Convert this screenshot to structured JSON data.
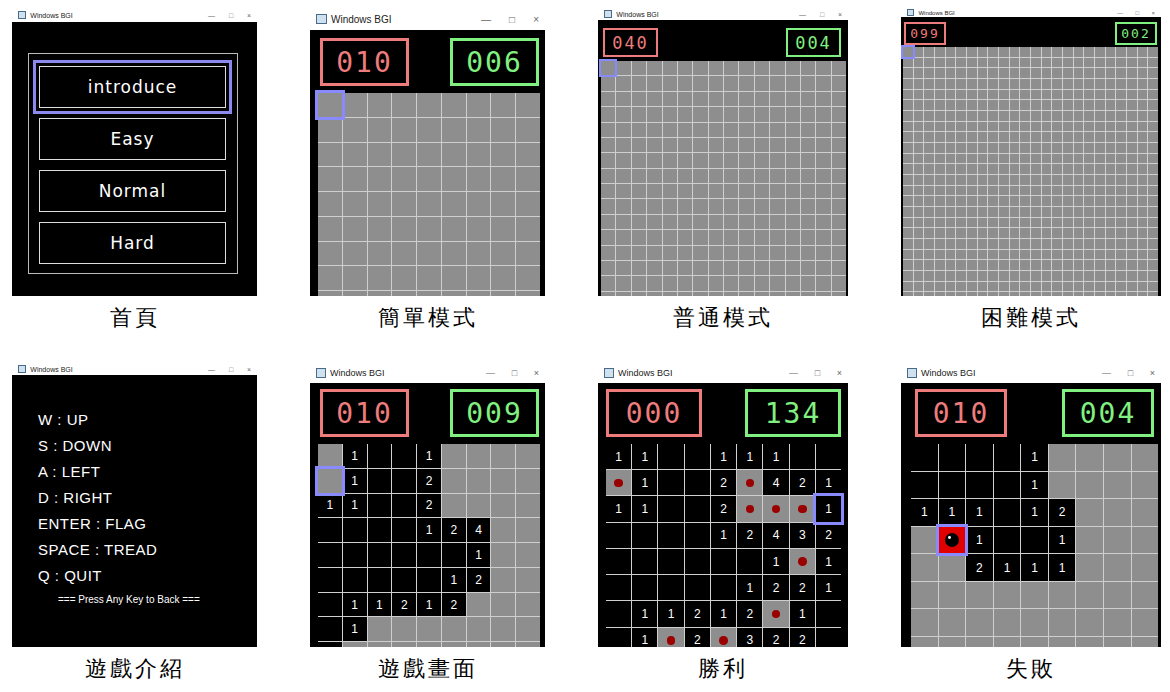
{
  "window": {
    "title": "Windows BGI",
    "controls": [
      "—",
      "□",
      "×"
    ]
  },
  "panels": [
    {
      "kind": "menu",
      "caption": "首頁",
      "options": [
        {
          "label": "introduce",
          "selected": true
        },
        {
          "label": "Easy",
          "selected": false
        },
        {
          "label": "Normal",
          "selected": false
        },
        {
          "label": "Hard",
          "selected": false
        }
      ]
    },
    {
      "kind": "board",
      "caption": "簡單模式",
      "mines": "010",
      "time": "006",
      "cursor": {
        "row": 0,
        "col": 0
      },
      "rows": [
        "#########",
        "#########",
        "#########",
        "#########",
        "#########",
        "#########",
        "#########",
        "#########",
        "#########"
      ]
    },
    {
      "kind": "board",
      "caption": "普通模式",
      "mines": "040",
      "time": "004",
      "cursor": {
        "row": 0,
        "col": 0
      },
      "rows": [
        "################",
        "################",
        "################",
        "################",
        "################",
        "################",
        "################",
        "################",
        "################",
        "################",
        "################",
        "################",
        "################",
        "################",
        "################",
        "################"
      ]
    },
    {
      "kind": "board",
      "caption": "困難模式",
      "mines": "099",
      "time": "002",
      "cursor": {
        "row": 0,
        "col": 0
      },
      "rows": [
        "########################",
        "########################",
        "########################",
        "########################",
        "########################",
        "########################",
        "########################",
        "########################",
        "########################",
        "########################",
        "########################",
        "########################",
        "########################",
        "########################",
        "########################",
        "########################",
        "########################",
        "########################",
        "########################",
        "########################",
        "########################",
        "########################",
        "########################",
        "########################"
      ]
    },
    {
      "kind": "intro",
      "caption": "遊戲介紹",
      "lines": [
        "W : UP",
        "S : DOWN",
        "A : LEFT",
        "D : RIGHT",
        "ENTER : FLAG",
        "SPACE : TREAD",
        "Q : QUIT"
      ],
      "hint": "=== Press Any Key to Back ==="
    },
    {
      "kind": "board",
      "caption": "遊戲畫面",
      "mines": "010",
      "time": "009",
      "cursor": {
        "row": 1,
        "col": 0
      },
      "rows": [
        "#1..1####",
        "#1..2####",
        "11..2####",
        "....124##",
        "......1##",
        ".....12##",
        ".11212###",
        ".1#######",
        ".########"
      ]
    },
    {
      "kind": "board",
      "caption": "勝利",
      "mines": "000",
      "time": "134",
      "cursor": {
        "row": 2,
        "col": 8
      },
      "rows": [
        "11..111..",
        "F1..2F421",
        "11..2FFF1",
        "....12432",
        "......1F1",
        ".....1221",
        ".11212F1.",
        ".1F2F322."
      ]
    },
    {
      "kind": "board",
      "caption": "失敗",
      "mines": "010",
      "time": "004",
      "cursor": {
        "row": 3,
        "col": 1
      },
      "rows": [
        "....1####",
        "....1####",
        "111.12###",
        "#*1..1###",
        "##2111###",
        "#########",
        "#########",
        "#########"
      ]
    }
  ]
}
